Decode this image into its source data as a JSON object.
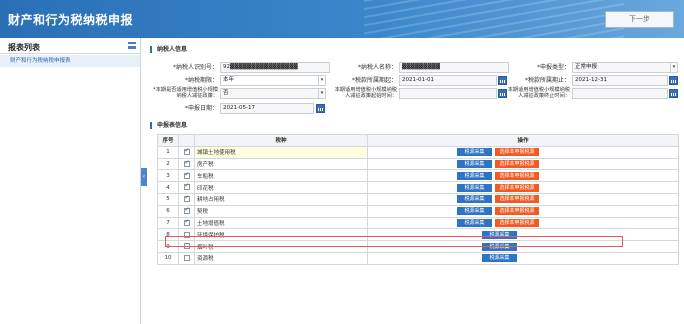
{
  "header": {
    "title": "财产和行为税纳税申报",
    "next_label": "下一步"
  },
  "sidebar": {
    "title": "报表列表",
    "items": [
      {
        "label": "财产和行为税纳税申报表"
      }
    ]
  },
  "taxpayer_section": {
    "title": "纳税人信息"
  },
  "fields": {
    "taxpayer_id": {
      "label": "*纳税人识别号：",
      "value": "92▓▓▓▓▓▓▓▓▓▓▓▓▓▓▓▓"
    },
    "taxpayer_name": {
      "label": "*纳税人名称：",
      "value": "▓▓▓▓▓▓▓▓▓"
    },
    "declare_type": {
      "label": "*申报类型：",
      "value": "正常申报"
    },
    "period_type": {
      "label": "*纳税期限：",
      "value": "本年"
    },
    "period_start": {
      "label": "*税款所属期起：",
      "value": "2021-01-01"
    },
    "period_end": {
      "label": "*税款所属期止：",
      "value": "2021-12-31"
    },
    "small_taxpayer": {
      "label": "*本期是否适用增值税小规模纳税人减征政策：",
      "value": "否"
    },
    "reduce_start": {
      "label": "本期适用增值税小规模纳税人减征政策起始时间：",
      "value": ""
    },
    "reduce_end": {
      "label": "本期适用增值税小规模纳税人减征政策终止时间：",
      "value": ""
    },
    "declare_date": {
      "label": "*申报日期：",
      "value": "2021-05-17"
    }
  },
  "report_section": {
    "title": "申报表信息"
  },
  "table": {
    "headers": {
      "no": "序号",
      "name": "税种",
      "op": "操作"
    },
    "collect_label": "税源采集",
    "select_label": "选择本申报税源",
    "rows": [
      {
        "no": "1",
        "name": "城镇土地使用税",
        "checked": true
      },
      {
        "no": "2",
        "name": "房产税",
        "checked": true
      },
      {
        "no": "3",
        "name": "车船税",
        "checked": true
      },
      {
        "no": "4",
        "name": "印花税",
        "checked": true
      },
      {
        "no": "5",
        "name": "耕地占用税",
        "checked": true
      },
      {
        "no": "6",
        "name": "契税",
        "checked": true
      },
      {
        "no": "7",
        "name": "土地增值税",
        "checked": true
      },
      {
        "no": "8",
        "name": "环境保护税",
        "checked": false
      },
      {
        "no": "9",
        "name": "烟叶税",
        "checked": false
      },
      {
        "no": "10",
        "name": "资源税",
        "checked": false
      }
    ]
  },
  "colors": {
    "primary": "#2f73c4",
    "accent": "#f15a22",
    "highlight": "#e35b5b"
  }
}
